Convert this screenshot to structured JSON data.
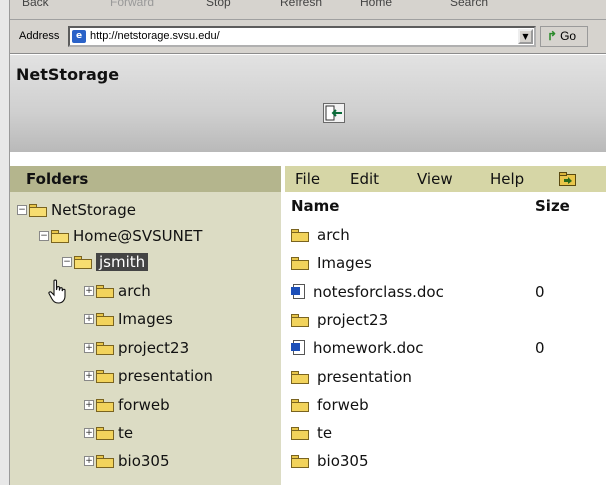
{
  "browser": {
    "toolbar_buttons": [
      "Back",
      "Forward",
      "Stop",
      "Refresh",
      "Home",
      "Search"
    ],
    "address_label": "Address",
    "address_url": "http://netstorage.svsu.edu/",
    "go_label": "Go"
  },
  "app": {
    "title": "NetStorage"
  },
  "folders": {
    "title": "Folders",
    "tree": [
      {
        "label": "NetStorage",
        "expander": "−"
      },
      {
        "label": "Home@SVSUNET",
        "expander": "−"
      },
      {
        "label": "jsmith",
        "expander": "−",
        "selected": true
      },
      {
        "label": "arch",
        "expander": "+"
      },
      {
        "label": "Images",
        "expander": "+"
      },
      {
        "label": "project23",
        "expander": "+"
      },
      {
        "label": "presentation",
        "expander": "+"
      },
      {
        "label": "forweb",
        "expander": "+"
      },
      {
        "label": "te",
        "expander": "+"
      },
      {
        "label": "bio305",
        "expander": "+"
      }
    ]
  },
  "menu": {
    "file": "File",
    "edit": "Edit",
    "view": "View",
    "help": "Help"
  },
  "file_list": {
    "name_header": "Name",
    "size_header": "Size",
    "items": [
      {
        "name": "arch",
        "type": "folder",
        "size": ""
      },
      {
        "name": "Images",
        "type": "folder",
        "size": ""
      },
      {
        "name": "notesforclass.doc",
        "type": "doc",
        "size": "0"
      },
      {
        "name": "project23",
        "type": "folder",
        "size": ""
      },
      {
        "name": "homework.doc",
        "type": "doc",
        "size": "0"
      },
      {
        "name": "presentation",
        "type": "folder",
        "size": ""
      },
      {
        "name": "forweb",
        "type": "folder",
        "size": ""
      },
      {
        "name": "te",
        "type": "folder",
        "size": ""
      },
      {
        "name": "bio305",
        "type": "folder",
        "size": ""
      }
    ]
  }
}
